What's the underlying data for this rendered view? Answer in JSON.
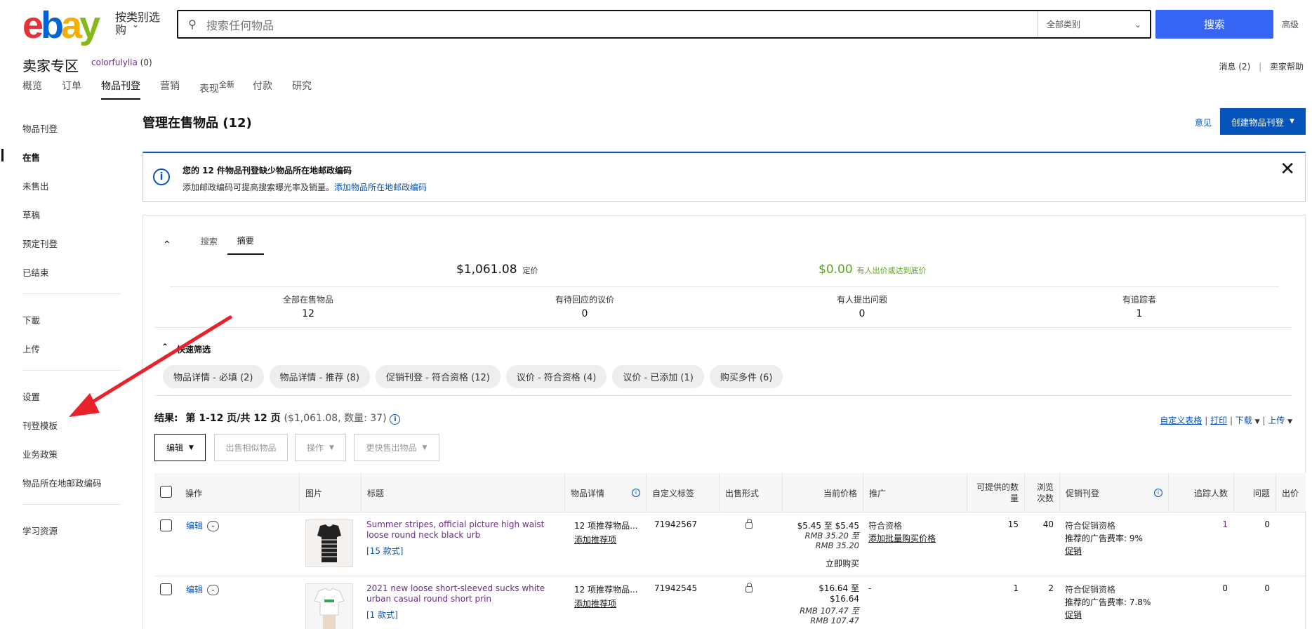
{
  "header": {
    "logo_letters": [
      "e",
      "b",
      "a",
      "y"
    ],
    "logo_colors": [
      "#e53238",
      "#0064d2",
      "#f5af02",
      "#86b817"
    ],
    "shop_by_category": "按类别选购",
    "search_placeholder": "搜索任何物品",
    "category_select": "全部类别",
    "search_button": "搜索",
    "advanced": "高级"
  },
  "hub": {
    "title": "卖家专区",
    "user": "colorfulylia",
    "user_score": "(0)",
    "messages": "消息 (2)",
    "separator": "|",
    "help": "卖家帮助"
  },
  "tabs": [
    {
      "label": "概览"
    },
    {
      "label": "订单"
    },
    {
      "label": "物品刊登",
      "active": true
    },
    {
      "label": "营销"
    },
    {
      "label": "表现",
      "badge": "全新"
    },
    {
      "label": "付款"
    },
    {
      "label": "研究"
    }
  ],
  "sidebar": {
    "items": [
      "物品刊登",
      "在售",
      "未售出",
      "草稿",
      "预定刊登",
      "已结束",
      "下載",
      "上传",
      "设置",
      "刊登模板",
      "业务政策",
      "物品所在地邮政编码",
      "学习资源"
    ],
    "active": "在售"
  },
  "page": {
    "title": "管理在售物品 (12)",
    "feedback": "意见",
    "create_button": "创建物品刊登"
  },
  "alert": {
    "heading": "您的 12 件物品刊登缺少物品所在地邮政编码",
    "body": "添加邮政编码可提高搜索曝光率及销量。",
    "link": "添加物品所在地邮政编码"
  },
  "panel_tabs": [
    "搜索",
    "摘要"
  ],
  "summary": {
    "fixed_price": "$1,061.08",
    "fixed_price_label": "定价",
    "bid_value": "$0.00",
    "bid_label": "有人出价或达到底价",
    "stats": [
      {
        "label": "全部在售物品",
        "value": "12"
      },
      {
        "label": "有待回应的议价",
        "value": "0"
      },
      {
        "label": "有人提出问题",
        "value": "0"
      },
      {
        "label": "有追踪者",
        "value": "1"
      }
    ]
  },
  "quick_filter": {
    "title": "快速筛选",
    "chips": [
      "物品详情 - 必填 (2)",
      "物品详情 - 推荐 (8)",
      "促销刊登 - 符合资格 (12)",
      "议价 - 符合资格 (4)",
      "议价 - 已添加 (1)",
      "购买多件 (6)"
    ]
  },
  "results": {
    "label": "结果:",
    "pages": "第 1-12 页/共 12 页",
    "detail": "($1,061.08, 数量: 37)",
    "customize": "自定义表格",
    "print": "打印",
    "download": "下载",
    "upload": "上传"
  },
  "toolbar": {
    "edit": "编辑",
    "sell_similar": "出售相似物品",
    "actions": "操作",
    "sell_faster": "更快售出物品"
  },
  "table": {
    "headers": [
      "操作",
      "图片",
      "标题",
      "物品详情",
      "自定义标签",
      "出售形式",
      "当前价格",
      "推广",
      "可提供的数量",
      "浏览次数",
      "促销刊登",
      "追踪人数",
      "问题",
      "出价"
    ],
    "rows": [
      {
        "action": "编辑",
        "title": "Summer stripes, official picture high waist loose round neck black urb",
        "variants": "[15 款式]",
        "details": "12 项推荐物品...",
        "details_link": "添加推荐项",
        "sku": "71942567",
        "price_usd": "$5.45 至 $5.45",
        "price_rmb": "RMB 35.20 至 RMB 35.20",
        "format": "立即购买",
        "promo_status": "符合资格",
        "promo_link": "添加批量购买价格",
        "qty": "15",
        "views": "40",
        "pl_status": "符合促销资格",
        "pl_rate": "推荐的广告费率: 9%",
        "pl_link": "促销",
        "watchers": "1",
        "questions": "0"
      },
      {
        "action": "编辑",
        "title": "2021 new loose short-sleeved sucks white urban casual round short prin",
        "variants": "[1 款式]",
        "details": "12 项推荐物品...",
        "details_link": "添加推荐项",
        "sku": "71942545",
        "price_usd": "$16.64 至 $16.64",
        "price_rmb": "RMB 107.47 至 RMB 107.47",
        "format": "",
        "promo_status": "-",
        "promo_link": "",
        "qty": "1",
        "views": "2",
        "pl_status": "符合促销资格",
        "pl_rate": "推荐的广告费率: 7.8%",
        "pl_link": "促销",
        "watchers": "0",
        "questions": "0"
      }
    ]
  }
}
